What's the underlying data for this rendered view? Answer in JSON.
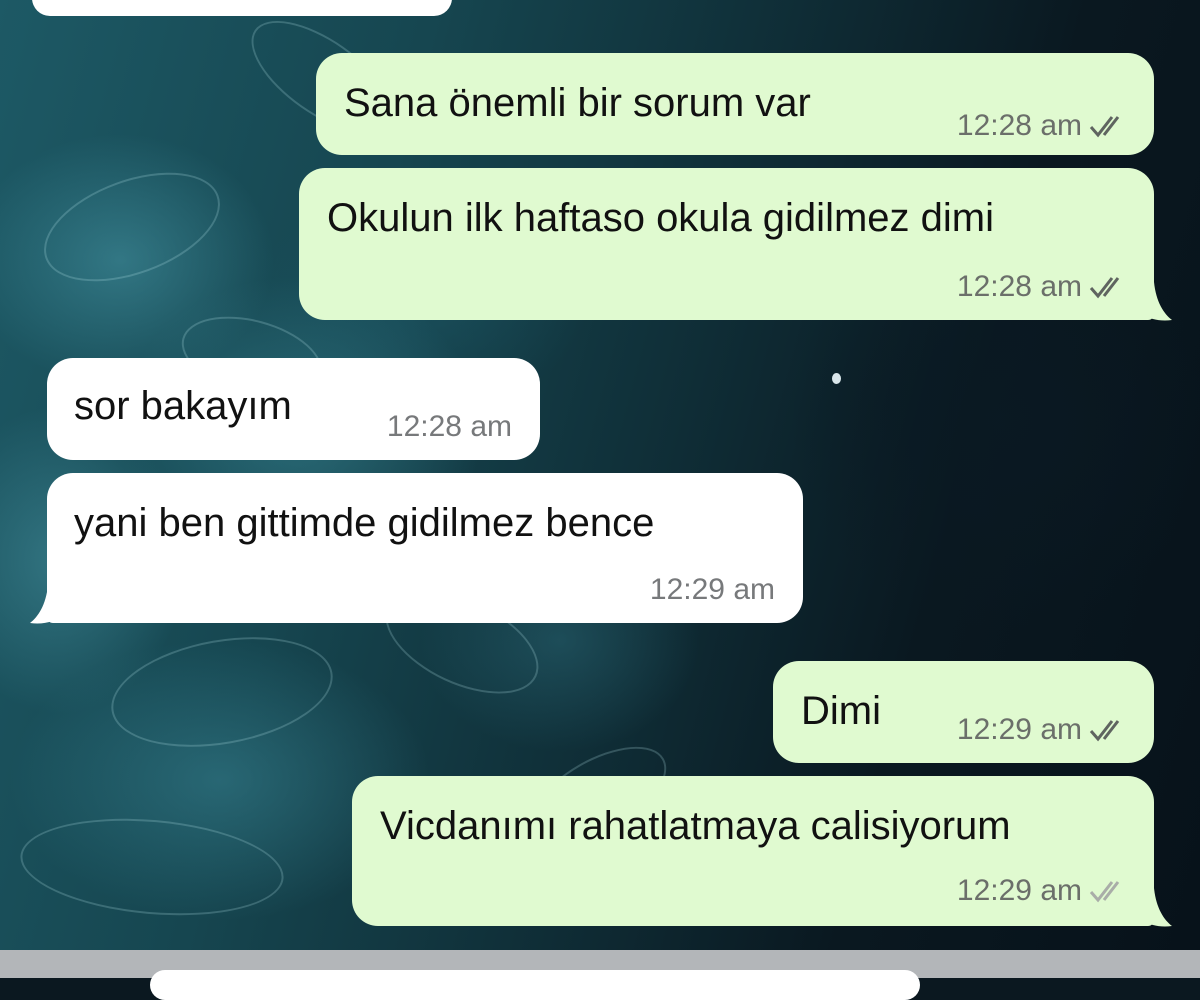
{
  "messages": [
    {
      "id": "m1",
      "direction": "outgoing",
      "text": "Sana önemli bir sorum var",
      "time": "12:28 am",
      "status": "read-double-check"
    },
    {
      "id": "m2",
      "direction": "outgoing",
      "text": "Okulun ilk haftaso okula gidilmez dimi",
      "time": "12:28 am",
      "status": "read-double-check"
    },
    {
      "id": "m3",
      "direction": "incoming",
      "text": "sor bakayım",
      "time": "12:28 am"
    },
    {
      "id": "m4",
      "direction": "incoming",
      "text": "yani ben gittimde gidilmez bence",
      "time": "12:29 am"
    },
    {
      "id": "m5",
      "direction": "outgoing",
      "text": "Dimi",
      "time": "12:29 am",
      "status": "read-double-check"
    },
    {
      "id": "m6",
      "direction": "outgoing",
      "text": "Vicdanımı rahatlatmaya calisiyorum",
      "time": "12:29 am",
      "status": "delivered-double-check"
    }
  ],
  "colors": {
    "outgoing_bubble": "#e0fad0",
    "incoming_bubble": "#ffffff",
    "read_tick": "#5f6460",
    "delivered_tick": "#a9ada8"
  },
  "icons": {
    "read_tick": "double-check-icon",
    "delivered_tick": "double-check-icon"
  }
}
